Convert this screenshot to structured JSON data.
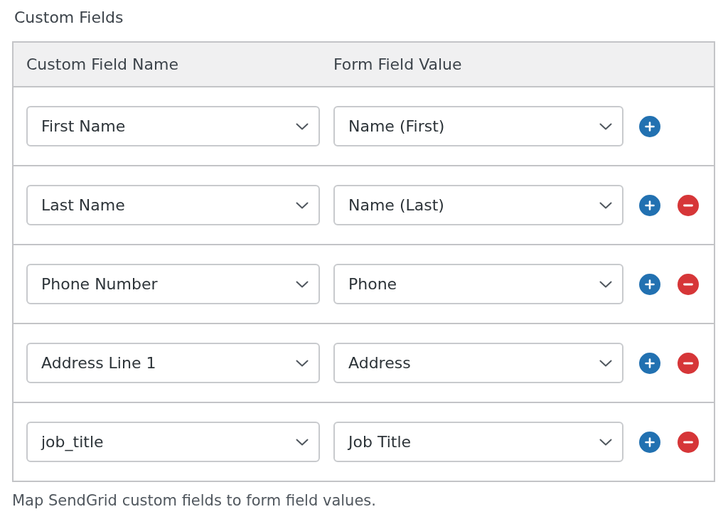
{
  "section_title": "Custom Fields",
  "table": {
    "columns": [
      "Custom Field Name",
      "Form Field Value"
    ],
    "rows": [
      {
        "custom_field": "First Name",
        "form_field": "Name (First)",
        "actions": [
          {
            "kind": "add"
          }
        ]
      },
      {
        "custom_field": "Last Name",
        "form_field": "Name (Last)",
        "actions": [
          {
            "kind": "add"
          },
          {
            "kind": "remove"
          }
        ]
      },
      {
        "custom_field": "Phone Number",
        "form_field": "Phone",
        "actions": [
          {
            "kind": "add"
          },
          {
            "kind": "remove"
          }
        ]
      },
      {
        "custom_field": "Address Line 1",
        "form_field": "Address",
        "actions": [
          {
            "kind": "add"
          },
          {
            "kind": "remove"
          }
        ]
      },
      {
        "custom_field": "job_title",
        "form_field": "Job Title",
        "actions": [
          {
            "kind": "add"
          },
          {
            "kind": "remove"
          }
        ]
      }
    ]
  },
  "description": "Map SendGrid custom fields to form field values."
}
